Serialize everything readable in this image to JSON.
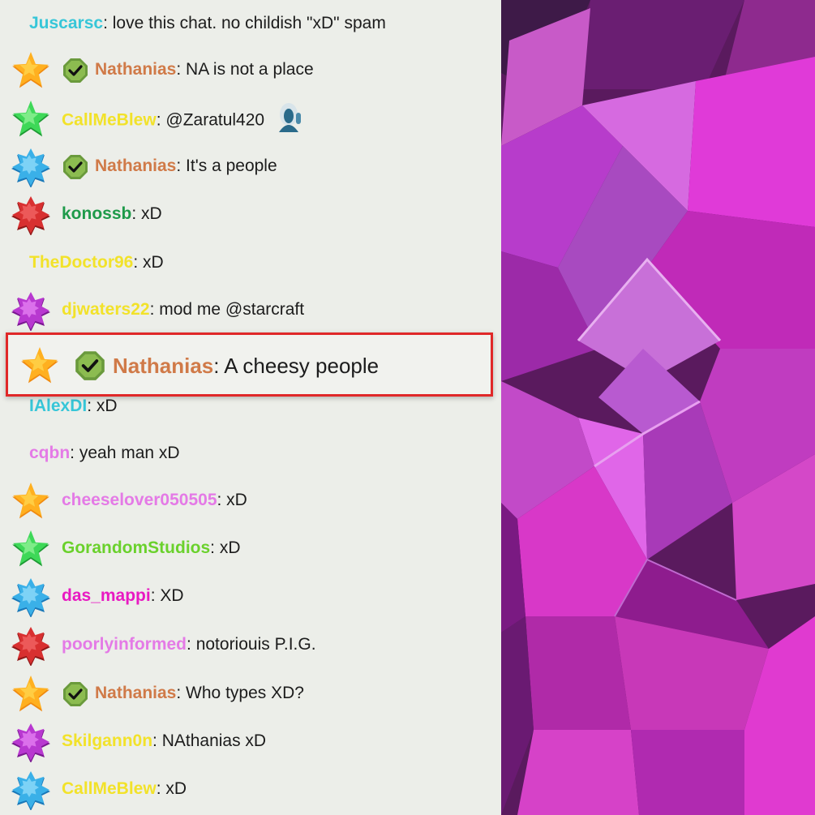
{
  "colors": {
    "chat_bg": "#eceee9",
    "highlight_border": "#e02828",
    "text": "#1c1c1c"
  },
  "messages": [
    {
      "user": "Juscarsc",
      "sep": ":",
      "text": " love this chat. no childish \"xD\" spam",
      "color": "#37c6d8",
      "badge": null,
      "mod": false
    },
    {
      "user": "Nathanias",
      "sep": ":",
      "text": " NA is not a place",
      "color": "#d07a48",
      "badge": "gold-star-icon",
      "mod": true
    },
    {
      "user": "CallMeBlew",
      "sep": ":",
      "text": " @Zaratul420",
      "color": "#f2e22a",
      "badge": "green-star-icon",
      "mod": false,
      "emote": "ghost-emote-icon"
    },
    {
      "user": "Nathanias",
      "sep": ":",
      "text": " It's a people",
      "color": "#d07a48",
      "badge": "blue-star-icon",
      "mod": true
    },
    {
      "user": "konossb",
      "sep": ":",
      "text": " xD",
      "color": "#1e9a4a",
      "badge": "red-star-icon",
      "mod": false
    },
    {
      "user": "TheDoctor96",
      "sep": ":",
      "text": " xD",
      "color": "#f2e22a",
      "badge": null,
      "mod": false
    },
    {
      "user": "djwaters22",
      "sep": ":",
      "text": " mod me @starcraft",
      "color": "#f2e22a",
      "badge": "purple-star-icon",
      "mod": false
    },
    {
      "user": "IAlexDI",
      "sep": ":",
      "text": " xD",
      "color": "#37c6d8",
      "badge": null,
      "mod": false
    },
    {
      "user": "cqbn",
      "sep": ":",
      "text": " yeah man xD",
      "color": "#e47ae6",
      "badge": null,
      "mod": false
    },
    {
      "user": "cheeselover050505",
      "sep": ":",
      "text": " xD",
      "color": "#e47ae6",
      "badge": "gold-star-icon",
      "mod": false
    },
    {
      "user": "GorandomStudios",
      "sep": ":",
      "text": " xD",
      "color": "#6ad12c",
      "badge": "green-star-icon",
      "mod": false
    },
    {
      "user": "das_mappi",
      "sep": ":",
      "text": " XD",
      "color": "#e81ac2",
      "badge": "blue-star-icon",
      "mod": false
    },
    {
      "user": "poorlyinformed",
      "sep": ":",
      "text": " notoriouis P.I.G.",
      "color": "#e47ae6",
      "badge": "red-star-icon",
      "mod": false
    },
    {
      "user": "Nathanias",
      "sep": ":",
      "text": " Who types XD?",
      "color": "#d07a48",
      "badge": "gold-star-icon",
      "mod": true
    },
    {
      "user": "Skilgann0n",
      "sep": ":",
      "text": " NAthanias xD",
      "color": "#f2e22a",
      "badge": "purple-star-icon",
      "mod": false
    },
    {
      "user": "CallMeBlew",
      "sep": ":",
      "text": " xD",
      "color": "#f2e22a",
      "badge": "blue-star-icon",
      "mod": false
    }
  ],
  "highlighted": {
    "user": "Nathanias",
    "sep": ":",
    "text": " A cheesy people",
    "color": "#d07a48",
    "badge": "gold-star-icon",
    "mod": true
  }
}
